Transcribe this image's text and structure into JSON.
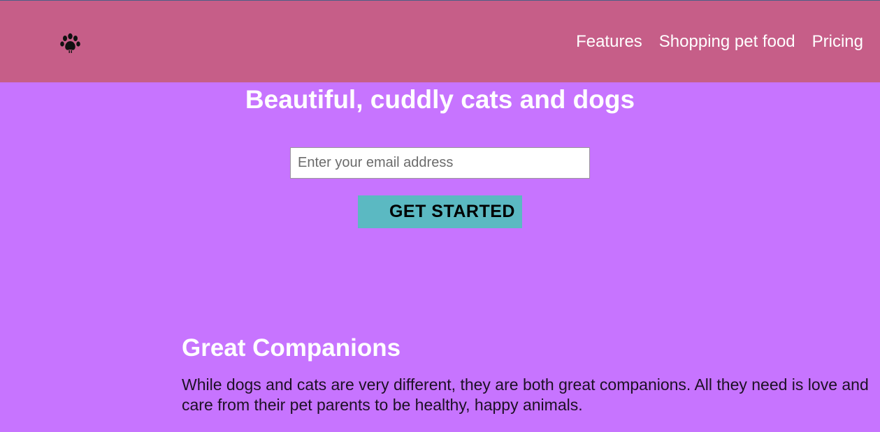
{
  "header": {
    "logo_icon": "paw-print-icon",
    "nav": [
      {
        "label": "Features"
      },
      {
        "label": "Shopping pet food"
      },
      {
        "label": "Pricing"
      }
    ]
  },
  "hero": {
    "title": "Beautiful, cuddly cats and dogs",
    "email_placeholder": "Enter your email address",
    "email_value": "",
    "cta_label": "GET STARTED"
  },
  "section": {
    "title": "Great Companions",
    "text": "While dogs and cats are very different, they are both great companions. All they need is love and care from their pet parents to be healthy, happy animals."
  },
  "colors": {
    "header_bg": "#c65e88",
    "page_bg": "#c774ff",
    "cta_bg": "#5bb9c2"
  }
}
